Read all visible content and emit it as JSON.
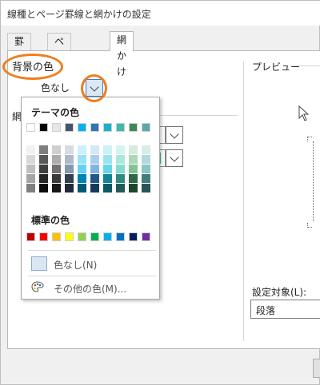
{
  "window": {
    "title": "線種とページ罫線と網かけの設定"
  },
  "tabs": [
    {
      "label": "罫線"
    },
    {
      "label": "ページ罫線"
    },
    {
      "label": "網かけ"
    }
  ],
  "shading": {
    "background_label": "背景の色",
    "background_value": "色なし",
    "pattern_label_partial": "網"
  },
  "preview": {
    "label": "プレビュー"
  },
  "apply_to": {
    "label": "設定対象(L):",
    "value": "段落"
  },
  "color_menu": {
    "theme_header": "テーマの色",
    "standard_header": "標準の色",
    "no_color_label": "色なし(N)",
    "more_colors_label": "その他の色(M)...",
    "theme_top_row": [
      "#ffffff",
      "#000000",
      "#e7e6e6",
      "#44546a",
      "#00b0f0",
      "#2e75b6",
      "#19b2c8",
      "#3fb9a9",
      "#3c8a5a",
      "#5aa8a8"
    ],
    "theme_shades": [
      [
        "#f2f2f2",
        "#7f7f7f",
        "#d0cece",
        "#d6dce4",
        "#ccf0fc",
        "#d5e6f5",
        "#ccf2f7",
        "#d5f3ee",
        "#d5ebdc",
        "#d8ecec"
      ],
      [
        "#d8d8d8",
        "#595959",
        "#aeabab",
        "#adb9ca",
        "#99e0f9",
        "#acccec",
        "#99e4ef",
        "#ace7dd",
        "#acd7b9",
        "#b1d9d9"
      ],
      [
        "#bfbfbf",
        "#3f3f3f",
        "#757171",
        "#8496b0",
        "#66d1f6",
        "#82b3e2",
        "#66d7e7",
        "#82dbcc",
        "#82c396",
        "#8ac6c6"
      ],
      [
        "#a5a5a5",
        "#262626",
        "#3a3838",
        "#333f4f",
        "#0084b4",
        "#225888",
        "#138596",
        "#2f8b7f",
        "#2d6843",
        "#437e7e"
      ],
      [
        "#7f7f7f",
        "#0c0c0c",
        "#171616",
        "#222a35",
        "#005878",
        "#163a5a",
        "#0c5964",
        "#1f5c54",
        "#1e452c",
        "#2d5454"
      ]
    ],
    "standard_colors": [
      "#c00000",
      "#ff0000",
      "#ffc000",
      "#ffff00",
      "#92d050",
      "#00b050",
      "#00b0f0",
      "#0070c0",
      "#002060",
      "#7030a0"
    ]
  },
  "colors": {
    "annotation": "#f07d1e",
    "accent": "#3d7ec7"
  }
}
